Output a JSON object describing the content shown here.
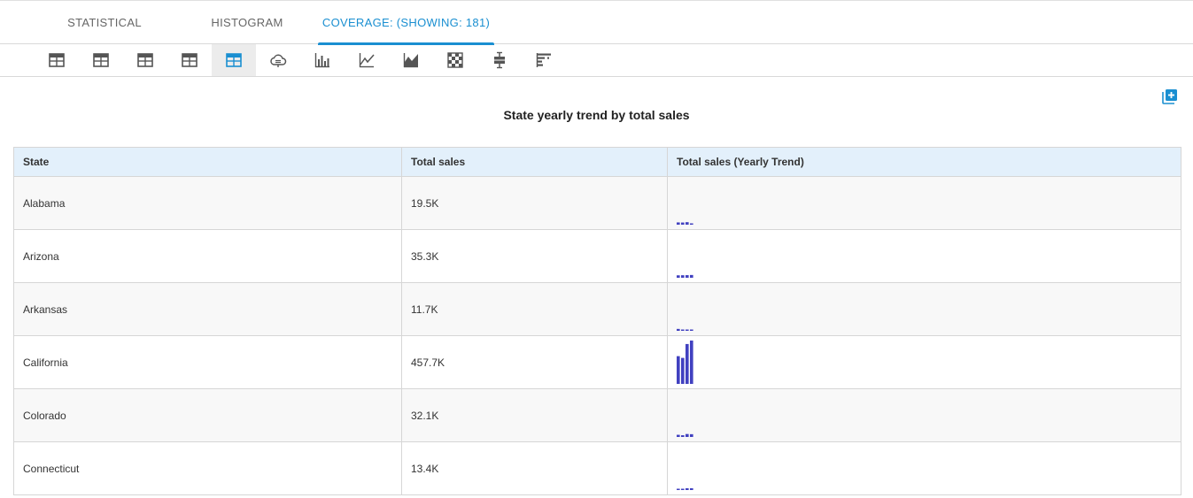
{
  "tabs": [
    {
      "label": "STATISTICAL"
    },
    {
      "label": "HISTOGRAM"
    },
    {
      "label": "COVERAGE: (SHOWING: 181)"
    }
  ],
  "toolbar": {
    "icons": [
      "table-icon",
      "table-icon",
      "table-icon",
      "table-icon",
      "table-icon-active",
      "cloud-icon",
      "bar-chart-icon",
      "line-chart-icon",
      "area-chart-icon",
      "heatmap-icon",
      "box-plot-icon",
      "stacked-bar-icon"
    ],
    "accent": "#1a8fd1"
  },
  "title": "State yearly trend by total sales",
  "table": {
    "columns": [
      "State",
      "Total sales",
      "Total sales (Yearly Trend)"
    ],
    "rows": [
      {
        "state": "Alabama",
        "total": "19.5K",
        "trend": [
          2.6,
          2.5,
          2.9,
          1.5
        ]
      },
      {
        "state": "Arizona",
        "total": "35.3K",
        "trend": [
          2.8,
          2.9,
          3.0,
          3.2
        ]
      },
      {
        "state": "Arkansas",
        "total": "11.7K",
        "trend": [
          2.2,
          1.2,
          1.2,
          1.2
        ]
      },
      {
        "state": "California",
        "total": "457.7K",
        "trend": [
          32,
          30,
          46,
          50
        ]
      },
      {
        "state": "Colorado",
        "total": "32.1K",
        "trend": [
          2.5,
          2.0,
          3.4,
          3.2
        ]
      },
      {
        "state": "Connecticut",
        "total": "13.4K",
        "trend": [
          1.2,
          1.2,
          2.1,
          2.1
        ]
      }
    ],
    "trend_color": "#4141c0"
  }
}
